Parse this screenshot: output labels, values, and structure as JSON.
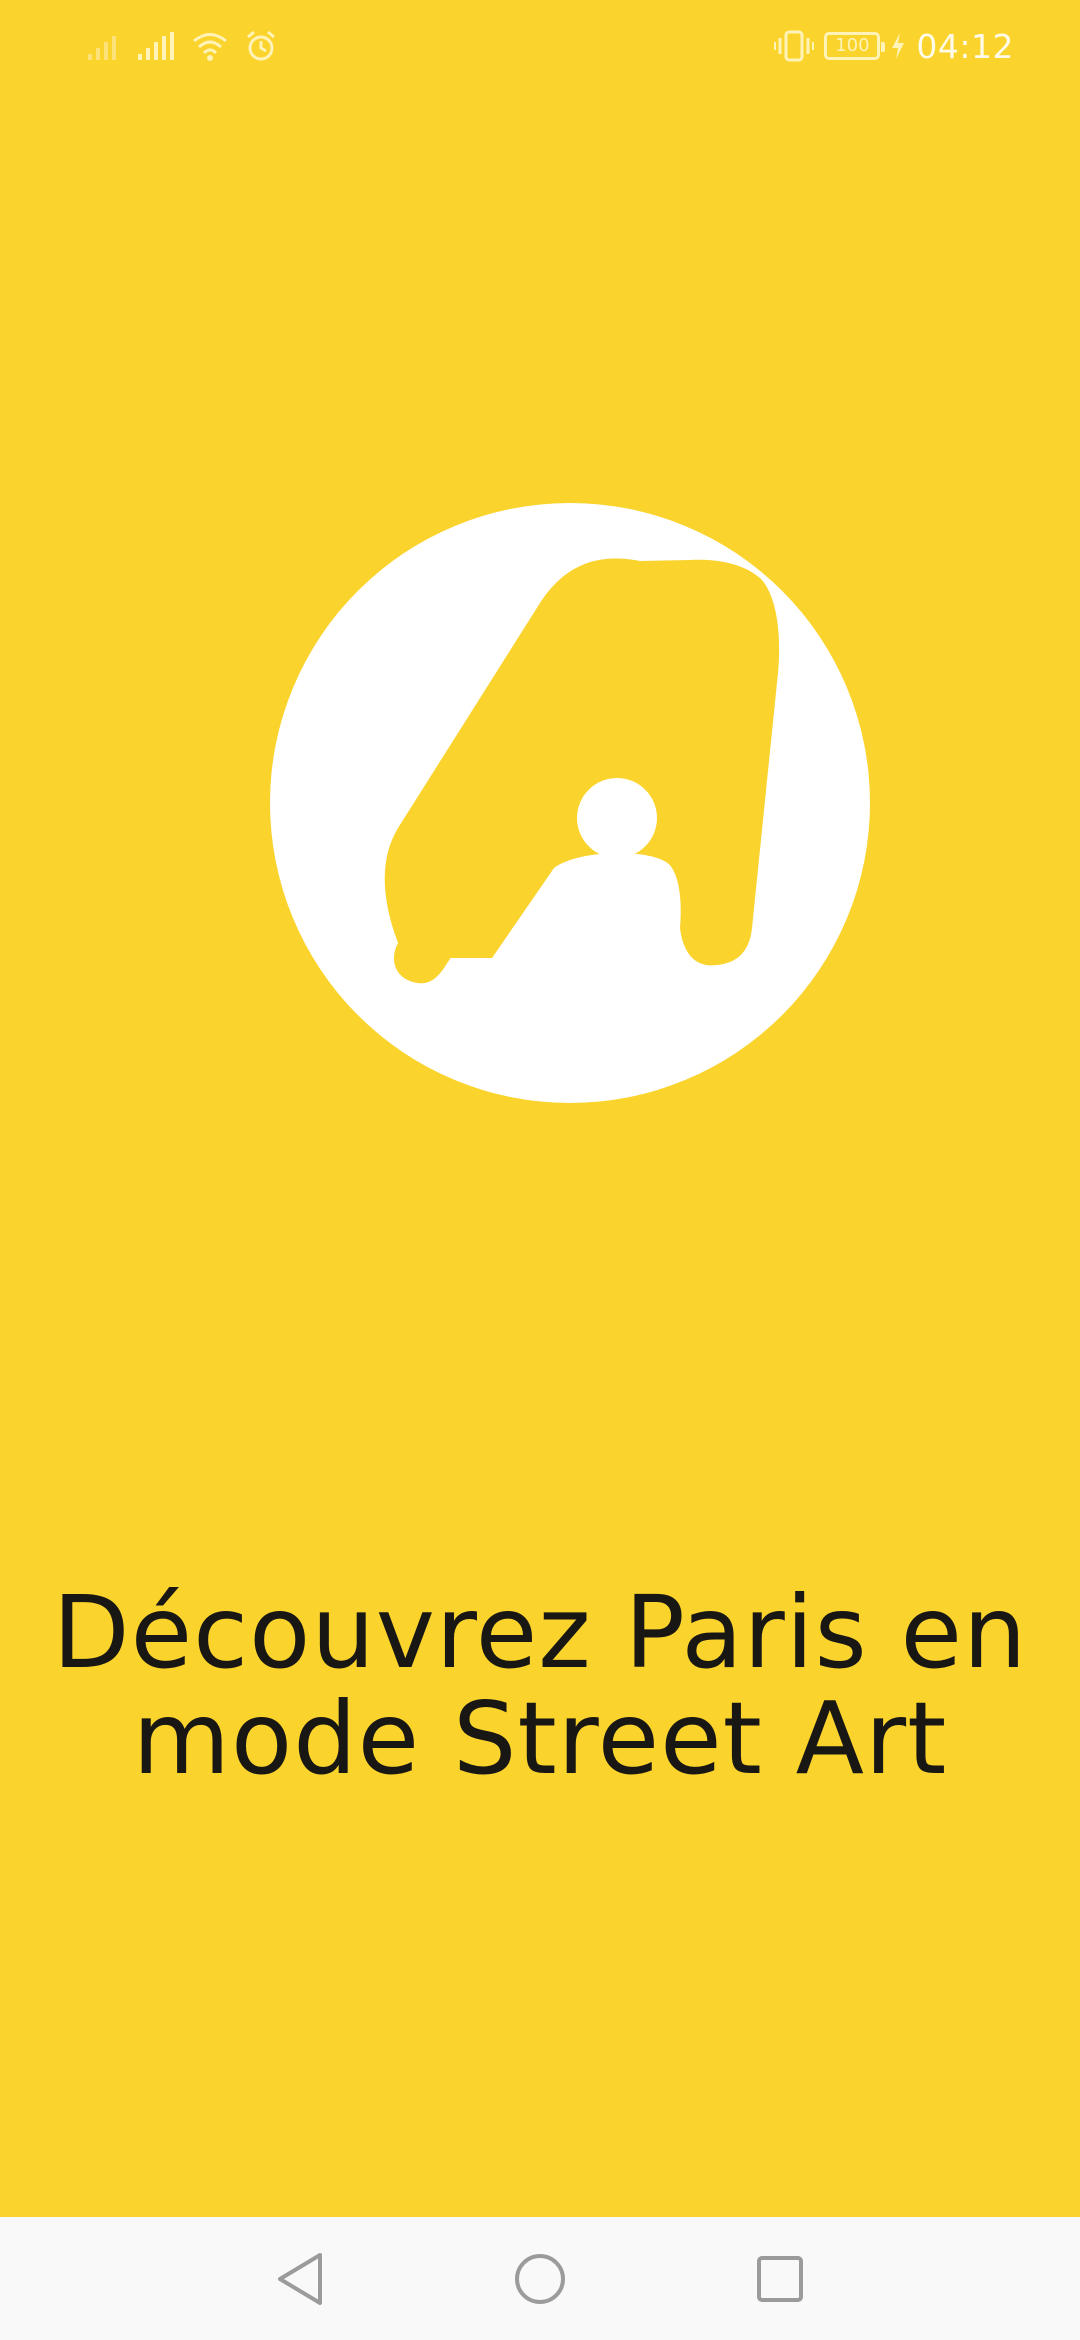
{
  "status_bar": {
    "time": "04:12",
    "battery_level": "100",
    "icons": [
      "signal-icon",
      "signal-icon",
      "wifi-icon",
      "alarm-icon",
      "vibrate-icon",
      "battery-icon",
      "charging-icon"
    ]
  },
  "splash": {
    "logo_icon": "letter-a-logo-icon",
    "tagline": "Découvrez Paris en mode Street Art",
    "background_color": "#fad32c",
    "logo_color": "#ffffff"
  },
  "nav_bar": {
    "icons": [
      "back-icon",
      "home-icon",
      "recents-icon"
    ]
  }
}
